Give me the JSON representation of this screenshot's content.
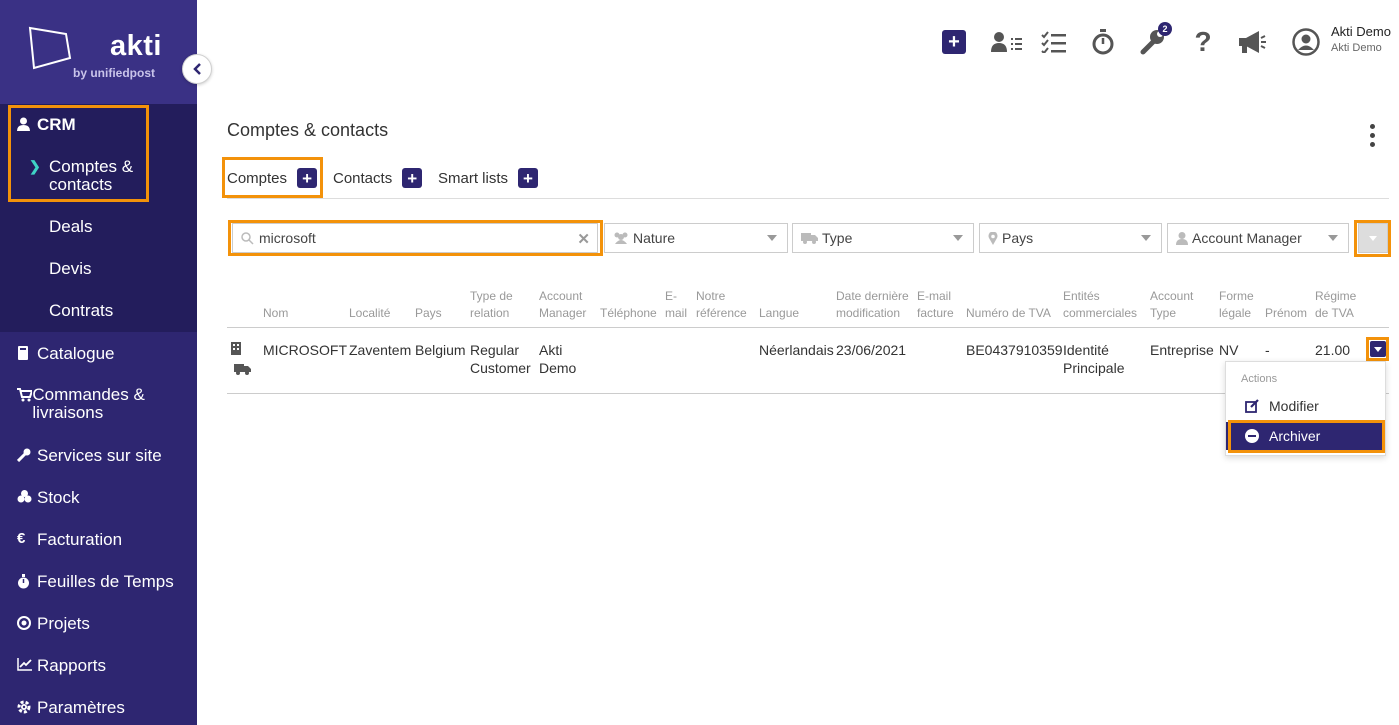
{
  "brand": {
    "name": "akti",
    "tagline": "by unifiedpost"
  },
  "sidebar": {
    "section": "CRM",
    "sub_items": [
      "Comptes & contacts",
      "Deals",
      "Devis",
      "Contrats"
    ],
    "items": [
      {
        "label": "Catalogue",
        "icon": "book-icon"
      },
      {
        "label": "Commandes & livraisons",
        "icon": "cart-icon"
      },
      {
        "label": "Services sur site",
        "icon": "wrench-icon"
      },
      {
        "label": "Stock",
        "icon": "boxes-icon"
      },
      {
        "label": "Facturation",
        "icon": "euro-icon"
      },
      {
        "label": "Feuilles de Temps",
        "icon": "stopwatch-icon"
      },
      {
        "label": "Projets",
        "icon": "target-icon"
      },
      {
        "label": "Rapports",
        "icon": "chart-icon"
      },
      {
        "label": "Paramètres",
        "icon": "gear-icon"
      }
    ]
  },
  "topbar": {
    "notifications_badge": "2",
    "user_name": "Akti Demo",
    "user_company": "Akti Demo"
  },
  "page": {
    "title": "Comptes & contacts"
  },
  "tabs": [
    {
      "label": "Comptes"
    },
    {
      "label": "Contacts"
    },
    {
      "label": "Smart lists"
    }
  ],
  "filters": {
    "search_value": "microsoft",
    "nature": "Nature",
    "type": "Type",
    "pays": "Pays",
    "account_manager": "Account Manager"
  },
  "table": {
    "headers": {
      "nom": "Nom",
      "localite": "Localité",
      "pays": "Pays",
      "type_relation_1": "Type de",
      "type_relation_2": "relation",
      "account_manager_1": "Account",
      "account_manager_2": "Manager",
      "telephone": "Téléphone",
      "email_1": "E-",
      "email_2": "mail",
      "notre_ref_1": "Notre",
      "notre_ref_2": "référence",
      "langue": "Langue",
      "date_1": "Date dernière",
      "date_2": "modification",
      "email_facture_1": "E-mail",
      "email_facture_2": "facture",
      "tva": "Numéro de TVA",
      "entites_1": "Entités",
      "entites_2": "commerciales",
      "account_type_1": "Account",
      "account_type_2": "Type",
      "forme_1": "Forme",
      "forme_2": "légale",
      "prenom": "Prénom",
      "regime_1": "Régime",
      "regime_2": "de TVA"
    },
    "row": {
      "nom": "MICROSOFT",
      "localite": "Zaventem",
      "pays": "Belgium",
      "type_relation_1": "Regular",
      "type_relation_2": "Customer",
      "account_manager_1": "Akti",
      "account_manager_2": "Demo",
      "langue": "Néerlandais",
      "date": "23/06/2021",
      "tva": "BE0437910359",
      "entites_1": "Identité",
      "entites_2": "Principale",
      "account_type": "Entreprise",
      "forme": "NV",
      "prenom": "-",
      "regime": "21.00"
    }
  },
  "actions_menu": {
    "title": "Actions",
    "modify": "Modifier",
    "archive": "Archiver"
  },
  "colors": {
    "primary": "#2e2671",
    "highlight": "#f3920a",
    "accent": "#3fd3c6"
  }
}
